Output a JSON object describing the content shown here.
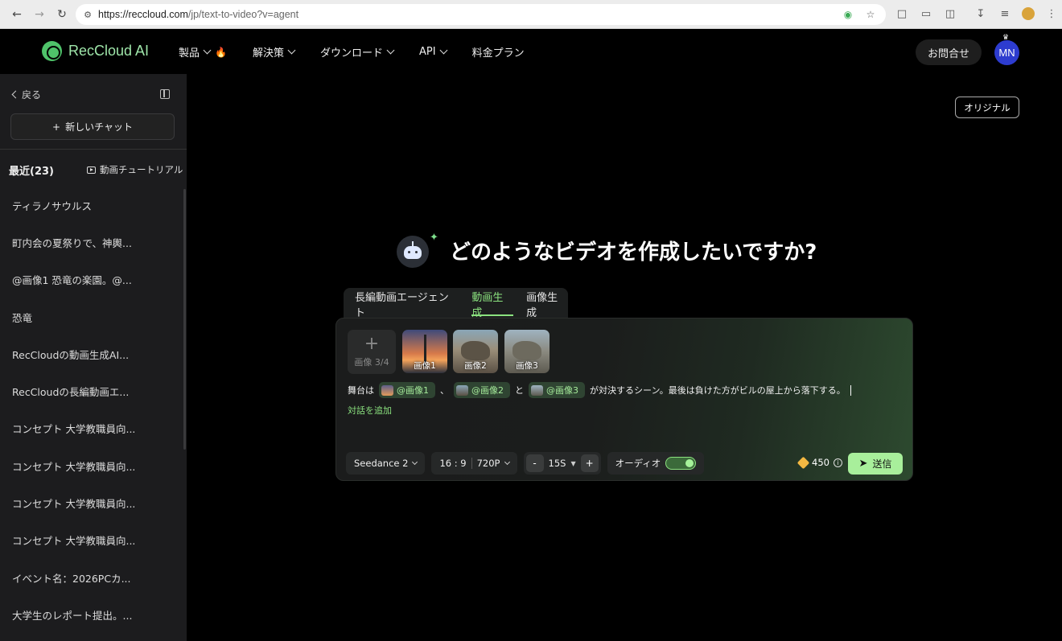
{
  "browser": {
    "url_host": "https://reccloud.com",
    "url_path": "/jp/text-to-video?v=agent"
  },
  "header": {
    "logo": "RecCloud AI",
    "nav": [
      {
        "label": "製品"
      },
      {
        "label": "解決策"
      },
      {
        "label": "ダウンロード"
      },
      {
        "label": "API"
      },
      {
        "label": "料金プラン"
      }
    ],
    "contact_label": "お問合せ",
    "avatar_initials": "MN"
  },
  "sidebar": {
    "back_label": "戻る",
    "new_chat_label": "新しいチャット",
    "recent_title": "最近(23)",
    "tutorial_label": "動画チュートリアル",
    "history": [
      "ティラノサウルス",
      "町内会の夏祭りで、神輿...",
      "@画像1 恐竜の楽園。@...",
      "恐竜",
      "RecCloudの動画生成AI...",
      "RecCloudの長編動画エ...",
      "コンセプト 大学教職員向...",
      "コンセプト 大学教職員向...",
      "コンセプト 大学教職員向...",
      "コンセプト 大学教職員向...",
      "イベント名：2026PCカ...",
      "大学生のレポート提出。..."
    ]
  },
  "main": {
    "original_label": "オリジナル",
    "hero_title": "どのようなビデオを作成したいですか?",
    "tabs": [
      {
        "label": "長編動画エージェント"
      },
      {
        "label": "動画生成"
      },
      {
        "label": "画像生成"
      }
    ],
    "composer": {
      "image_count": "画像 3/4",
      "images": [
        "画像1",
        "画像2",
        "画像3"
      ],
      "prompt": {
        "prefix": "舞台は",
        "chip1": "@画像1",
        "sep1": "、",
        "chip2": "@画像2",
        "sep2": "と",
        "chip3": "@画像3",
        "suffix": "が対決するシーン。最後は負けた方がビルの屋上から落下する。"
      },
      "add_dialog": "対話を追加",
      "model": "Seedance 2",
      "ratio": "16 : 9",
      "resolution": "720P",
      "minus": "-",
      "duration": "15S",
      "plus": "+",
      "audio_label": "オーディオ",
      "audio_on": true,
      "credits": "450",
      "send_label": "送信"
    }
  },
  "colors": {
    "accent": "#8be27f",
    "brand": "#4fc36a",
    "avatar": "#2d3ccf"
  }
}
